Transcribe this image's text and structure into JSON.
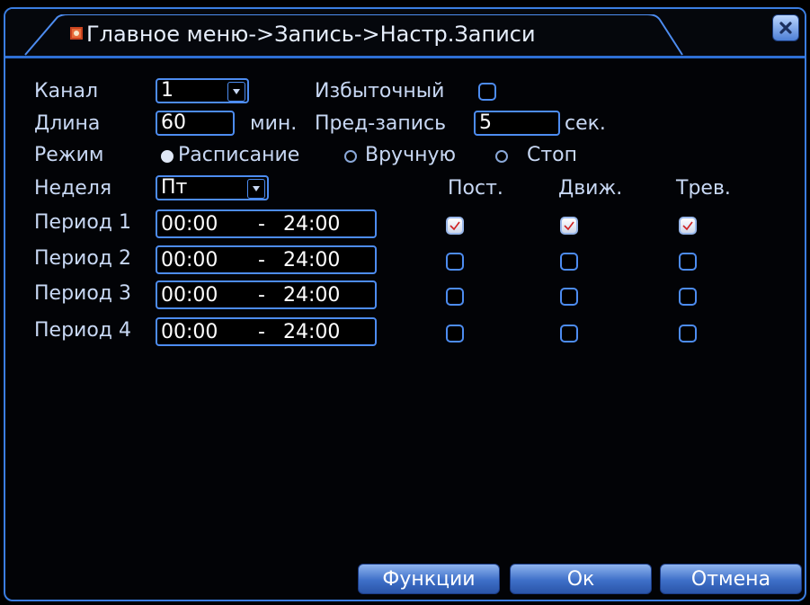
{
  "window": {
    "title": "Главное меню->Запись->Настр.Записи",
    "close_icon": "close-x-icon"
  },
  "channel": {
    "label": "Канал",
    "value": "1"
  },
  "redundant": {
    "label": "Избыточный",
    "checked": false
  },
  "length": {
    "label": "Длина",
    "value": "60",
    "unit": "мин."
  },
  "prerecord": {
    "label": "Пред-запись",
    "value": "5",
    "unit": "сек."
  },
  "mode": {
    "label": "Режим",
    "options": [
      {
        "label": "Расписание",
        "selected": true
      },
      {
        "label": "Вручную",
        "selected": false
      },
      {
        "label": "Стоп",
        "selected": false
      }
    ]
  },
  "week": {
    "label": "Неделя",
    "value": "Пт"
  },
  "columns": {
    "regular": "Пост.",
    "motion": "Движ.",
    "alarm": "Трев."
  },
  "periods": [
    {
      "label": "Период 1",
      "start": "00:00",
      "sep": "-",
      "end": "24:00",
      "regular": true,
      "motion": true,
      "alarm": true
    },
    {
      "label": "Период 2",
      "start": "00:00",
      "sep": "-",
      "end": "24:00",
      "regular": false,
      "motion": false,
      "alarm": false
    },
    {
      "label": "Период 3",
      "start": "00:00",
      "sep": "-",
      "end": "24:00",
      "regular": false,
      "motion": false,
      "alarm": false
    },
    {
      "label": "Период 4",
      "start": "00:00",
      "sep": "-",
      "end": "24:00",
      "regular": false,
      "motion": false,
      "alarm": false
    }
  ],
  "buttons": {
    "functions": "Функции",
    "ok": "Ок",
    "cancel": "Отмена"
  },
  "colors": {
    "accent": "#4d8cf0",
    "check_mark": "#d02020"
  }
}
